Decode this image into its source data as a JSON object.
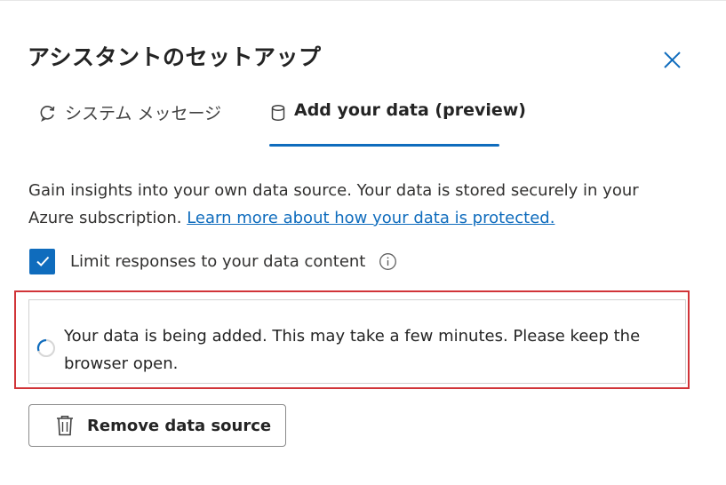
{
  "dialog": {
    "title": "アシスタントのセットアップ"
  },
  "tabs": [
    {
      "label": "システム メッセージ",
      "icon": "refresh-chat-icon",
      "selected": false
    },
    {
      "label": "Add your data (preview)",
      "icon": "database-icon",
      "selected": true
    }
  ],
  "description": {
    "text": "Gain insights into your own data source. Your data is stored securely in your Azure subscription. ",
    "link_text": "Learn more about how your data is protected."
  },
  "checkbox": {
    "label": "Limit responses to your data content",
    "checked": true
  },
  "status": {
    "message": "Your data is being added. This may take a few minutes. Please keep the browser open."
  },
  "remove_button": {
    "label": "Remove data source"
  },
  "colors": {
    "accent": "#0f6cbd",
    "highlight_outline": "#d13438",
    "text": "#242424"
  }
}
